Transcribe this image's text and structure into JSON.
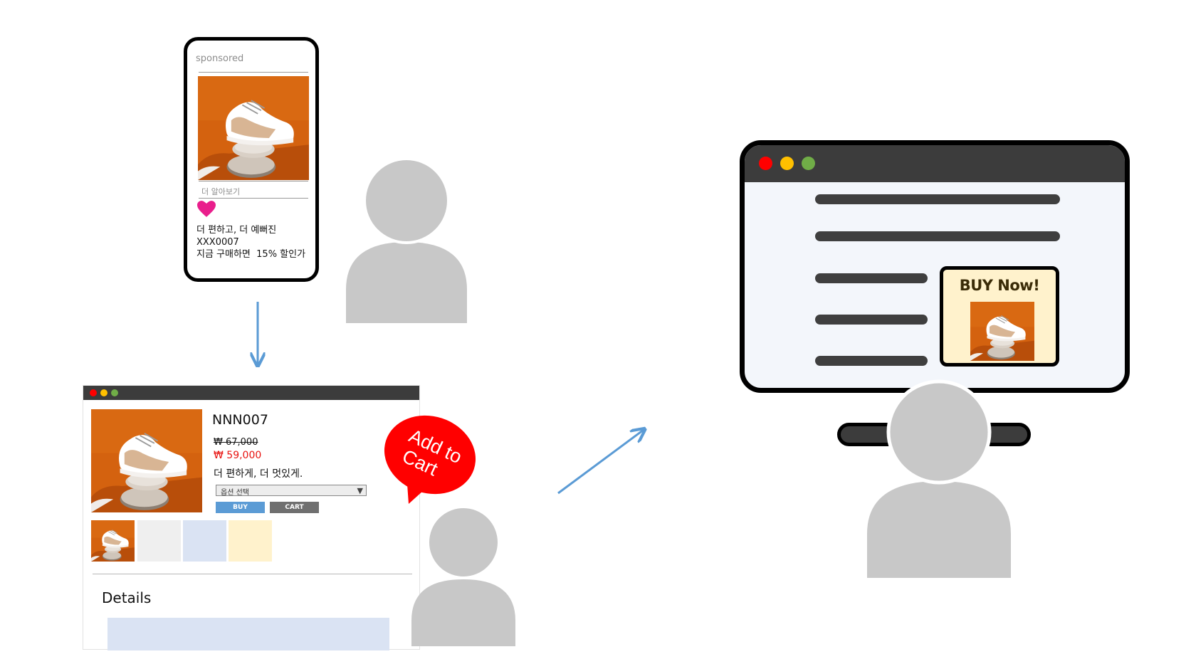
{
  "phone_ad": {
    "sponsored": "sponsored",
    "learn_more": "더 알아보기",
    "heart_icon": "heart-icon",
    "lines": [
      "더 편하고, 더 예뻐진",
      "XXX0007",
      "지금 구매하면  15% 할인가"
    ]
  },
  "product_page": {
    "name": "NNN007",
    "old_price": "₩ 67,000",
    "new_price": "₩ 59,000",
    "description": "더 편하게, 더 멋있게.",
    "option_select": "옵션 선택",
    "buy_button": "BUY",
    "cart_button": "CART",
    "details": "Details",
    "thumbnail_colors": [
      "#efefef",
      "#dae3f3",
      "#fff2cc"
    ]
  },
  "speech_bubble": {
    "line1": "Add to",
    "line2": "Cart"
  },
  "monitor_ad": {
    "label": "BUY Now!"
  },
  "colors": {
    "arrow": "#5b9bd5",
    "person": "#c8c8c8",
    "bubble": "#ff0000",
    "price_red": "#e8110e",
    "window_bar": "#3c3c3c",
    "dot_red": "#ff0000",
    "dot_yellow": "#ffc000",
    "dot_green": "#70ad47",
    "heart": "#e91e8c"
  }
}
